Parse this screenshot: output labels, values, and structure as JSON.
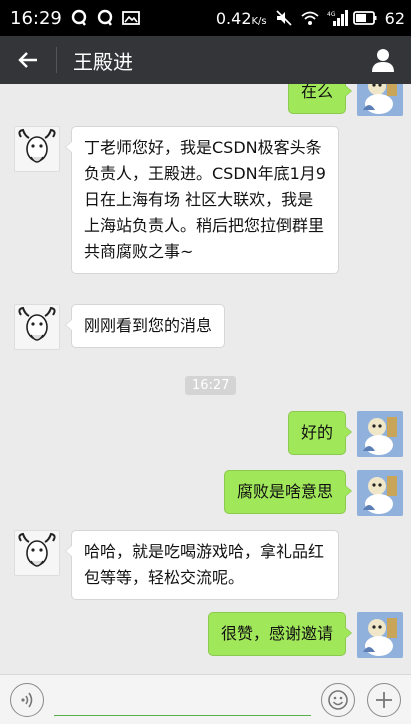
{
  "status_bar": {
    "time": "16:29",
    "speed": "0.42",
    "speed_unit": "K/s",
    "network": "4G",
    "battery": "62"
  },
  "title_bar": {
    "title": "王殿进"
  },
  "messages": [
    {
      "dir": "out",
      "text": "在么",
      "avatar": "cartoon-avatar"
    },
    {
      "dir": "in",
      "text": "丁老师您好，我是CSDN极客头条负责人，王殿进。CSDN年底1月9日在上海有场 社区大联欢，我是上海站负责人。稍后把您拉倒群里共商腐败之事~",
      "avatar": "gnu-avatar"
    },
    {
      "dir": "in",
      "text": "刚刚看到您的消息",
      "avatar": "gnu-avatar"
    },
    {
      "dir": "out",
      "text": "好的",
      "avatar": "cartoon-avatar"
    },
    {
      "dir": "out",
      "text": "腐败是啥意思",
      "avatar": "cartoon-avatar"
    },
    {
      "dir": "in",
      "text": "哈哈，就是吃喝游戏哈，拿礼品红包等等，轻松交流呢。",
      "avatar": "gnu-avatar"
    },
    {
      "dir": "out",
      "text": "很赞，感谢邀请",
      "avatar": "cartoon-avatar"
    }
  ],
  "timestamp": "16:27",
  "input_bar": {
    "placeholder": ""
  },
  "colors": {
    "titlebar_bg": "#333538",
    "outgoing_bubble": "#a0e75a",
    "incoming_bubble": "#ffffff",
    "chat_bg": "#ebebeb",
    "input_underline": "#56b248"
  }
}
